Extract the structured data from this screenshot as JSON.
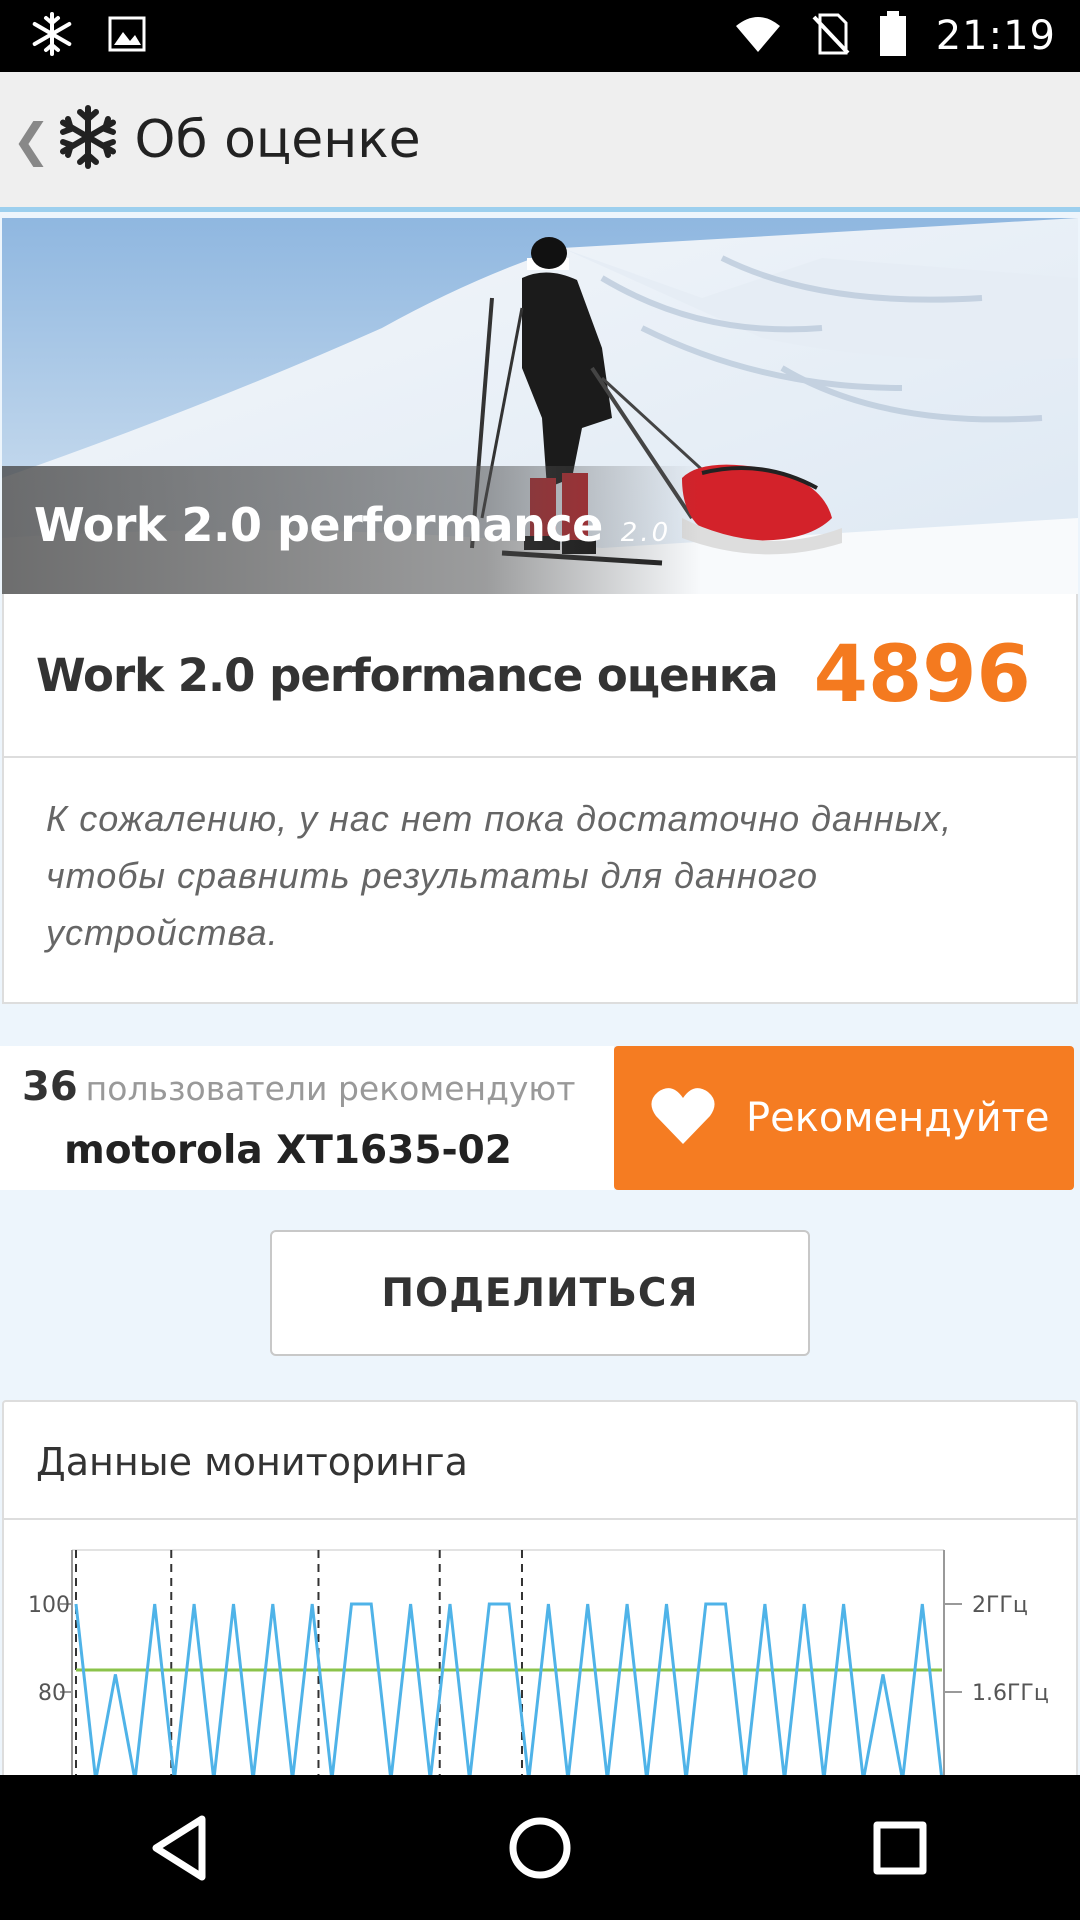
{
  "status_bar": {
    "time": "21:19",
    "icons_left": [
      "snowflake-icon",
      "image-icon"
    ],
    "icons_right": [
      "wifi-icon",
      "no-sim-icon",
      "battery-icon"
    ]
  },
  "app_bar": {
    "title": "Об оценке",
    "back_symbol": "❮"
  },
  "hero": {
    "title": "Work 2.0 performance",
    "version": "2.0"
  },
  "score": {
    "label": "Work 2.0 performance оценка",
    "value": "4896"
  },
  "note": {
    "text": "К сожалению, у нас нет пока достаточно данных, чтобы сравнить результаты для данного устройства."
  },
  "recommend": {
    "count": "36",
    "text": "пользователи рекомендуют",
    "device": "motorola XT1635-02",
    "button_label": "Рекомендуйте"
  },
  "share": {
    "button_label": "ПОДЕЛИТЬСЯ"
  },
  "monitoring": {
    "title": "Данные мониторинга"
  },
  "chart_data": {
    "type": "line",
    "title": "",
    "y_left_ticks": [
      "100",
      "80"
    ],
    "y_right_ticks": [
      "2ГГц",
      "1.6ГГц"
    ],
    "series": [
      {
        "color": "#8bc34a",
        "values": [
          85,
          85,
          85,
          85,
          85,
          85,
          85,
          85,
          85,
          85
        ]
      },
      {
        "color": "#4fb3e8",
        "values": [
          100,
          60,
          84,
          60,
          100,
          60,
          100,
          60,
          100,
          60,
          100,
          60,
          100,
          60,
          100,
          100,
          60,
          100,
          60,
          100,
          60,
          100,
          100,
          60,
          100,
          60,
          100,
          60,
          100,
          60,
          100,
          60,
          100,
          100,
          60,
          100,
          60,
          100,
          60,
          100,
          60,
          84,
          60,
          100,
          60
        ]
      }
    ],
    "markers": 5,
    "colors": {
      "cpu": "#4fb3e8",
      "temp": "#8bc34a"
    }
  },
  "nav": {
    "icons": [
      "back-triangle-icon",
      "home-circle-icon",
      "recents-square-icon"
    ]
  },
  "colors": {
    "accent": "#f47a1f",
    "app_bar_bg": "#efefef",
    "app_bar_border": "#9ccfee",
    "page_bg": "#edf5fc"
  }
}
